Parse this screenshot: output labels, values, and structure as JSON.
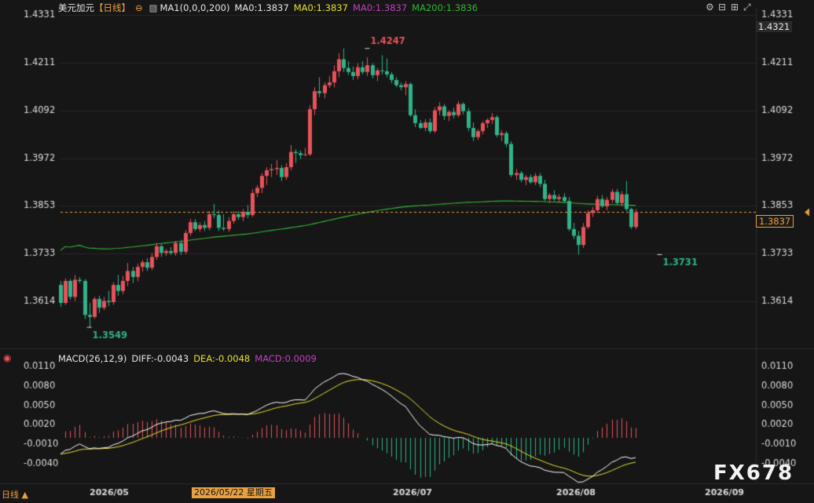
{
  "header": {
    "symbol": "美元加元",
    "period_tag": "【日线】",
    "ma_main_label": "MA1(0,0,0,200)",
    "ma_white": "MA0:1.3837",
    "ma_yellow": "MA0:1.3837",
    "ma_purple": "MA0:1.3837",
    "ma_green": "MA200:1.3836"
  },
  "macd_header": {
    "label": "MACD(26,12,9)",
    "diff": "DIFF:-0.0043",
    "dea": "DEA:-0.0048",
    "macd": "MACD:0.0009"
  },
  "right_boxes": {
    "top_price": "1.4321",
    "current_price": "1.3837"
  },
  "footer": {
    "period_button": "日线 ▲",
    "selected_date": "2026/05/22 星期五"
  },
  "watermark": "FX678",
  "icons": [
    "settings-icon",
    "zoom-out-icon",
    "zoom-in-icon",
    "expand-icon",
    "close-icon",
    "target-icon"
  ],
  "colors": {
    "up": "#e8525b",
    "down": "#2fb389",
    "ma200": "#35b535",
    "diff": "#ffffff",
    "dea": "#e8e030",
    "macd_label": "#c040c0",
    "current_line": "#e8a040"
  },
  "chart_data": [
    {
      "type": "candlestick",
      "title": "美元加元 日线",
      "x_tick_labels": [
        "2026/05",
        "2026/07",
        "2026/08",
        "2026/09"
      ],
      "y_tick_labels": [
        "1.4331",
        "1.4211",
        "1.4092",
        "1.3972",
        "1.3853",
        "1.3733",
        "1.3614"
      ],
      "ylim": [
        1.35,
        1.4331
      ],
      "annotations": [
        {
          "text": "1.4247",
          "index": 64,
          "value": 1.4247,
          "kind": "high"
        },
        {
          "text": "1.3731",
          "index": 125,
          "value": 1.3731,
          "kind": "low"
        },
        {
          "text": "1.3549",
          "index": 6,
          "value": 1.3549,
          "kind": "low"
        }
      ],
      "current_price": 1.3837,
      "candles_ohlc": [
        [
          1.3655,
          1.3665,
          1.36,
          1.361
        ],
        [
          1.361,
          1.3672,
          1.3605,
          1.3665
        ],
        [
          1.3665,
          1.367,
          1.3618,
          1.3625
        ],
        [
          1.3625,
          1.368,
          1.3615,
          1.3668
        ],
        [
          1.3668,
          1.3675,
          1.366,
          1.3665
        ],
        [
          1.3665,
          1.367,
          1.357,
          1.358
        ],
        [
          1.358,
          1.361,
          1.3549,
          1.3575
        ],
        [
          1.3575,
          1.3625,
          1.357,
          1.362
        ],
        [
          1.362,
          1.3628,
          1.3585,
          1.3598
        ],
        [
          1.3598,
          1.3625,
          1.3592,
          1.3615
        ],
        [
          1.3615,
          1.364,
          1.3602,
          1.3612
        ],
        [
          1.3612,
          1.3662,
          1.3605,
          1.3655
        ],
        [
          1.3655,
          1.368,
          1.3628,
          1.364
        ],
        [
          1.364,
          1.3678,
          1.3632,
          1.3665
        ],
        [
          1.3665,
          1.371,
          1.3652,
          1.369
        ],
        [
          1.369,
          1.37,
          1.366,
          1.3675
        ],
        [
          1.3675,
          1.3708,
          1.3664,
          1.37
        ],
        [
          1.37,
          1.3718,
          1.3688,
          1.3712
        ],
        [
          1.3712,
          1.3722,
          1.369,
          1.3698
        ],
        [
          1.3698,
          1.3735,
          1.3692,
          1.3725
        ],
        [
          1.3725,
          1.376,
          1.3718,
          1.3752
        ],
        [
          1.3752,
          1.3758,
          1.3725,
          1.3735
        ],
        [
          1.3735,
          1.3745,
          1.3728,
          1.374
        ],
        [
          1.374,
          1.375,
          1.373,
          1.3735
        ],
        [
          1.3735,
          1.3765,
          1.3728,
          1.376
        ],
        [
          1.376,
          1.3768,
          1.373,
          1.3738
        ],
        [
          1.3738,
          1.3792,
          1.3732,
          1.3785
        ],
        [
          1.3785,
          1.382,
          1.3778,
          1.3812
        ],
        [
          1.3812,
          1.382,
          1.379,
          1.3795
        ],
        [
          1.3795,
          1.3812,
          1.3788,
          1.3805
        ],
        [
          1.3805,
          1.3815,
          1.379,
          1.3798
        ],
        [
          1.3798,
          1.384,
          1.3792,
          1.3832
        ],
        [
          1.3832,
          1.3858,
          1.3822,
          1.383
        ],
        [
          1.383,
          1.3842,
          1.379,
          1.3798
        ],
        [
          1.3798,
          1.3832,
          1.379,
          1.3795
        ],
        [
          1.3795,
          1.3825,
          1.3788,
          1.3815
        ],
        [
          1.3815,
          1.384,
          1.3808,
          1.3832
        ],
        [
          1.3832,
          1.384,
          1.3818,
          1.3825
        ],
        [
          1.3825,
          1.3845,
          1.3815,
          1.3838
        ],
        [
          1.3838,
          1.3855,
          1.3822,
          1.383
        ],
        [
          1.383,
          1.3895,
          1.3825,
          1.3885
        ],
        [
          1.3885,
          1.3905,
          1.3875,
          1.3898
        ],
        [
          1.3898,
          1.3935,
          1.3885,
          1.3928
        ],
        [
          1.3928,
          1.395,
          1.3905,
          1.3942
        ],
        [
          1.3942,
          1.3958,
          1.3925,
          1.3945
        ],
        [
          1.3945,
          1.3968,
          1.393,
          1.3948
        ],
        [
          1.3948,
          1.3955,
          1.3915,
          1.3925
        ],
        [
          1.3925,
          1.396,
          1.3918,
          1.395
        ],
        [
          1.395,
          1.4005,
          1.3942,
          1.3988
        ],
        [
          1.3988,
          1.3995,
          1.396,
          1.3985
        ],
        [
          1.3985,
          1.3992,
          1.397,
          1.398
        ],
        [
          1.398,
          1.3998,
          1.3978,
          1.3982
        ],
        [
          1.3982,
          1.4105,
          1.3978,
          1.4095
        ],
        [
          1.4095,
          1.415,
          1.408,
          1.414
        ],
        [
          1.414,
          1.4175,
          1.4125,
          1.4135
        ],
        [
          1.4135,
          1.4162,
          1.4122,
          1.4155
        ],
        [
          1.4155,
          1.4178,
          1.4148,
          1.4162
        ],
        [
          1.4162,
          1.4205,
          1.415,
          1.419
        ],
        [
          1.419,
          1.4235,
          1.4175,
          1.422
        ],
        [
          1.422,
          1.4247,
          1.4188,
          1.4198
        ],
        [
          1.4198,
          1.4215,
          1.418,
          1.4188
        ],
        [
          1.4188,
          1.4202,
          1.4168,
          1.4178
        ],
        [
          1.4178,
          1.421,
          1.417,
          1.42
        ],
        [
          1.42,
          1.4215,
          1.4182,
          1.4188
        ],
        [
          1.4188,
          1.4225,
          1.4178,
          1.4205
        ],
        [
          1.4205,
          1.421,
          1.4172,
          1.418
        ],
        [
          1.418,
          1.4198,
          1.4165,
          1.4192
        ],
        [
          1.4192,
          1.423,
          1.4182,
          1.419
        ],
        [
          1.419,
          1.4222,
          1.4175,
          1.4182
        ],
        [
          1.4182,
          1.4188,
          1.416,
          1.4168
        ],
        [
          1.4168,
          1.4175,
          1.415,
          1.4155
        ],
        [
          1.4155,
          1.4162,
          1.4142,
          1.415
        ],
        [
          1.415,
          1.4165,
          1.413,
          1.4158
        ],
        [
          1.4158,
          1.4162,
          1.4075,
          1.408
        ],
        [
          1.408,
          1.4095,
          1.405,
          1.406
        ],
        [
          1.406,
          1.4068,
          1.4045,
          1.4048
        ],
        [
          1.4048,
          1.407,
          1.404,
          1.4062
        ],
        [
          1.4062,
          1.4072,
          1.4035,
          1.404
        ],
        [
          1.404,
          1.41,
          1.4035,
          1.4092
        ],
        [
          1.4092,
          1.4112,
          1.408,
          1.4102
        ],
        [
          1.4102,
          1.4108,
          1.4068,
          1.4078
        ],
        [
          1.4078,
          1.4092,
          1.4065,
          1.4088
        ],
        [
          1.4088,
          1.4098,
          1.4072,
          1.408
        ],
        [
          1.408,
          1.4115,
          1.4075,
          1.4108
        ],
        [
          1.4108,
          1.4112,
          1.4082,
          1.409
        ],
        [
          1.409,
          1.4098,
          1.404,
          1.4048
        ],
        [
          1.4048,
          1.4062,
          1.4015,
          1.4025
        ],
        [
          1.4025,
          1.4045,
          1.4018,
          1.404
        ],
        [
          1.404,
          1.4065,
          1.4032,
          1.406
        ],
        [
          1.406,
          1.4072,
          1.4048,
          1.4068
        ],
        [
          1.4068,
          1.4085,
          1.4058,
          1.4075
        ],
        [
          1.4075,
          1.408,
          1.4025,
          1.403
        ],
        [
          1.403,
          1.4042,
          1.4015,
          1.4035
        ],
        [
          1.4035,
          1.404,
          1.4,
          1.4008
        ],
        [
          1.4008,
          1.4015,
          1.3925,
          1.393
        ],
        [
          1.393,
          1.3945,
          1.3918,
          1.3935
        ],
        [
          1.3935,
          1.394,
          1.3912,
          1.3918
        ],
        [
          1.3918,
          1.393,
          1.3905,
          1.3925
        ],
        [
          1.3925,
          1.3932,
          1.3908,
          1.3912
        ],
        [
          1.3912,
          1.3935,
          1.3905,
          1.3928
        ],
        [
          1.3928,
          1.3935,
          1.39,
          1.3908
        ],
        [
          1.3908,
          1.3918,
          1.3865,
          1.387
        ],
        [
          1.387,
          1.3885,
          1.386,
          1.388
        ],
        [
          1.388,
          1.3892,
          1.3865,
          1.387
        ],
        [
          1.387,
          1.3882,
          1.3862,
          1.3875
        ],
        [
          1.3875,
          1.3885,
          1.386,
          1.3865
        ],
        [
          1.3865,
          1.3875,
          1.379,
          1.3795
        ],
        [
          1.3795,
          1.381,
          1.377,
          1.3778
        ],
        [
          1.3778,
          1.379,
          1.3731,
          1.3755
        ],
        [
          1.3755,
          1.381,
          1.3748,
          1.38
        ],
        [
          1.38,
          1.3842,
          1.3795,
          1.3835
        ],
        [
          1.3835,
          1.385,
          1.3825,
          1.3842
        ],
        [
          1.3842,
          1.3878,
          1.3835,
          1.387
        ],
        [
          1.387,
          1.388,
          1.3848,
          1.3852
        ],
        [
          1.3852,
          1.3875,
          1.3842,
          1.3868
        ],
        [
          1.3868,
          1.3895,
          1.386,
          1.3888
        ],
        [
          1.3888,
          1.3895,
          1.3855,
          1.386
        ],
        [
          1.386,
          1.389,
          1.3852,
          1.3882
        ],
        [
          1.3882,
          1.3915,
          1.384,
          1.3845
        ],
        [
          1.3845,
          1.3848,
          1.3795,
          1.38
        ],
        [
          1.38,
          1.3845,
          1.3795,
          1.3837
        ]
      ],
      "series": [
        {
          "name": "MA200",
          "values": "computed from candles_ohlc close (200-period)"
        }
      ]
    },
    {
      "type": "line",
      "title": "MACD(26,12,9)",
      "y_tick_labels": [
        "0.0110",
        "0.0080",
        "0.0050",
        "0.0020",
        "-0.0010",
        "-0.0040"
      ],
      "ylim": [
        -0.0045,
        0.012
      ],
      "series": [
        {
          "name": "DIFF",
          "last": -0.0043
        },
        {
          "name": "DEA",
          "last": -0.0048
        },
        {
          "name": "MACD",
          "last": 0.0009
        }
      ]
    }
  ]
}
